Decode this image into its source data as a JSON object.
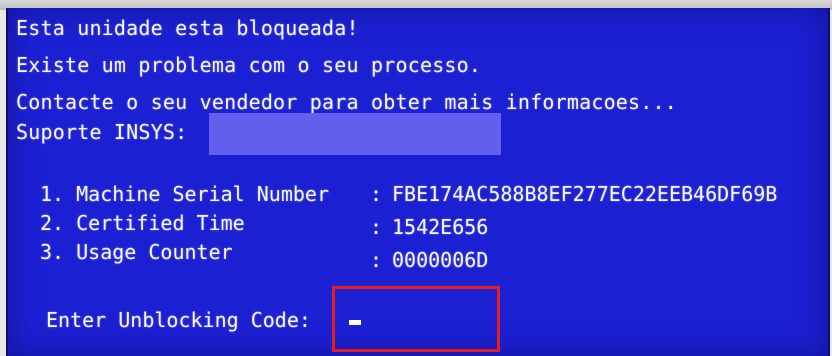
{
  "screen": {
    "bg_color": "#1c20d3",
    "text_color": "#f7f7ff",
    "header_lines": [
      "Esta unidade esta bloqueada!",
      "Existe um problema com o seu processo.",
      "Contacte o seu vendedor para obter mais informacoes..."
    ],
    "support_label": "Suporte INSYS:",
    "details": [
      {
        "label": "1. Machine Serial Number",
        "colon": ":",
        "value": "FBE174AC588B8EF277EC22EEB46DF69B"
      },
      {
        "label": "2. Certified Time",
        "colon": ":",
        "value": "1542E656"
      },
      {
        "label": "3. Usage Counter",
        "colon": ":",
        "value": "0000006D"
      }
    ],
    "entry_label": "Enter Unblocking Code:",
    "entry_value": "_",
    "highlight_color": "#ea1b1b"
  }
}
